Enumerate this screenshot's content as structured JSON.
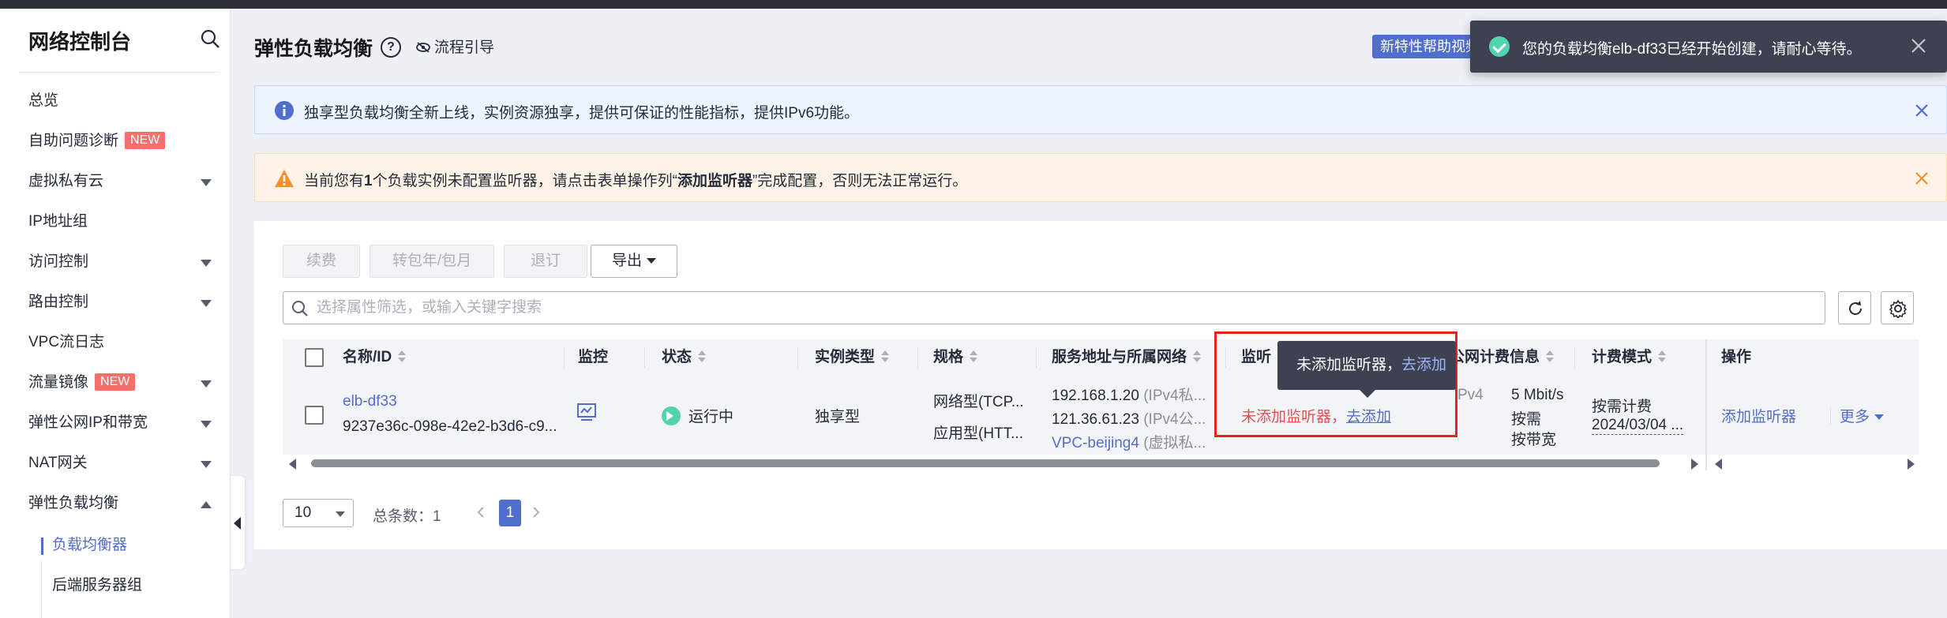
{
  "sidebar": {
    "title": "网络控制台",
    "items": [
      {
        "label": "总览"
      },
      {
        "label": "自助问题诊断",
        "badge": "NEW"
      },
      {
        "label": "虚拟私有云"
      },
      {
        "label": "IP地址组"
      },
      {
        "label": "访问控制"
      },
      {
        "label": "路由控制"
      },
      {
        "label": "VPC流日志"
      },
      {
        "label": "流量镜像",
        "badge": "NEW"
      },
      {
        "label": "弹性公网IP和带宽"
      },
      {
        "label": "NAT网关"
      },
      {
        "label": "弹性负载均衡"
      }
    ],
    "sub_items": [
      {
        "label": "负载均衡器"
      },
      {
        "label": "后端服务器组"
      }
    ]
  },
  "header": {
    "title": "弹性负载均衡",
    "help": "?",
    "guide": "流程引导",
    "new_feature": "新特性帮助视频"
  },
  "toast": {
    "message": "您的负载均衡elb-df33已经开始创建，请耐心等待。"
  },
  "alerts": {
    "info": "独享型负载均衡全新上线，实例资源独享，提供可保证的性能指标，提供IPv6功能。",
    "warn_prefix": "当前您有",
    "warn_count": "1",
    "warn_mid": "个负载实例未配置监听器，请点击表单操作列“",
    "warn_action": "添加监听器",
    "warn_suffix": "”完成配置，否则无法正常运行。"
  },
  "toolbar": {
    "renew": "续费",
    "to_yearly": "转包年/包月",
    "unsubscribe": "退订",
    "export": "导出"
  },
  "search": {
    "placeholder": "选择属性筛选，或输入关键字搜索"
  },
  "table": {
    "headers": {
      "name": "名称/ID",
      "monitor": "监控",
      "status": "状态",
      "type": "实例类型",
      "spec": "规格",
      "address": "服务地址与所属网络",
      "listener": "监听器",
      "eip_billing": "公网计费信息",
      "billing_mode": "计费模式",
      "ops": "操作"
    },
    "row": {
      "name": "elb-df33",
      "id": "9237e36c-098e-42e2-b3d6-c9...",
      "status": "运行中",
      "type": "独享型",
      "spec1": "网络型(TCP...",
      "spec2": "应用型(HTT...",
      "ip1": "192.168.1.20",
      "ip1_tag": "(IPv4私...",
      "ip2": "121.36.61.23",
      "ip2_tag": "(IPv4公...",
      "vpc": "VPC-beijing4",
      "vpc_tag": "(虚拟私...",
      "listener_none": "未添加监听器，",
      "listener_add": "去添加",
      "eip_partial": "Pv4",
      "bandwidth": "5 Mbit/s",
      "bill_type": "按需",
      "bill_by": "按带宽",
      "billing_mode": "按需计费",
      "billing_date": "2024/03/04 ...",
      "op_add": "添加监听器",
      "op_more": "更多"
    }
  },
  "tooltip": {
    "text": "未添加监听器，",
    "link": "去添加"
  },
  "pagination": {
    "page_size": "10",
    "total_label": "总条数：",
    "total": "1",
    "current": "1"
  }
}
